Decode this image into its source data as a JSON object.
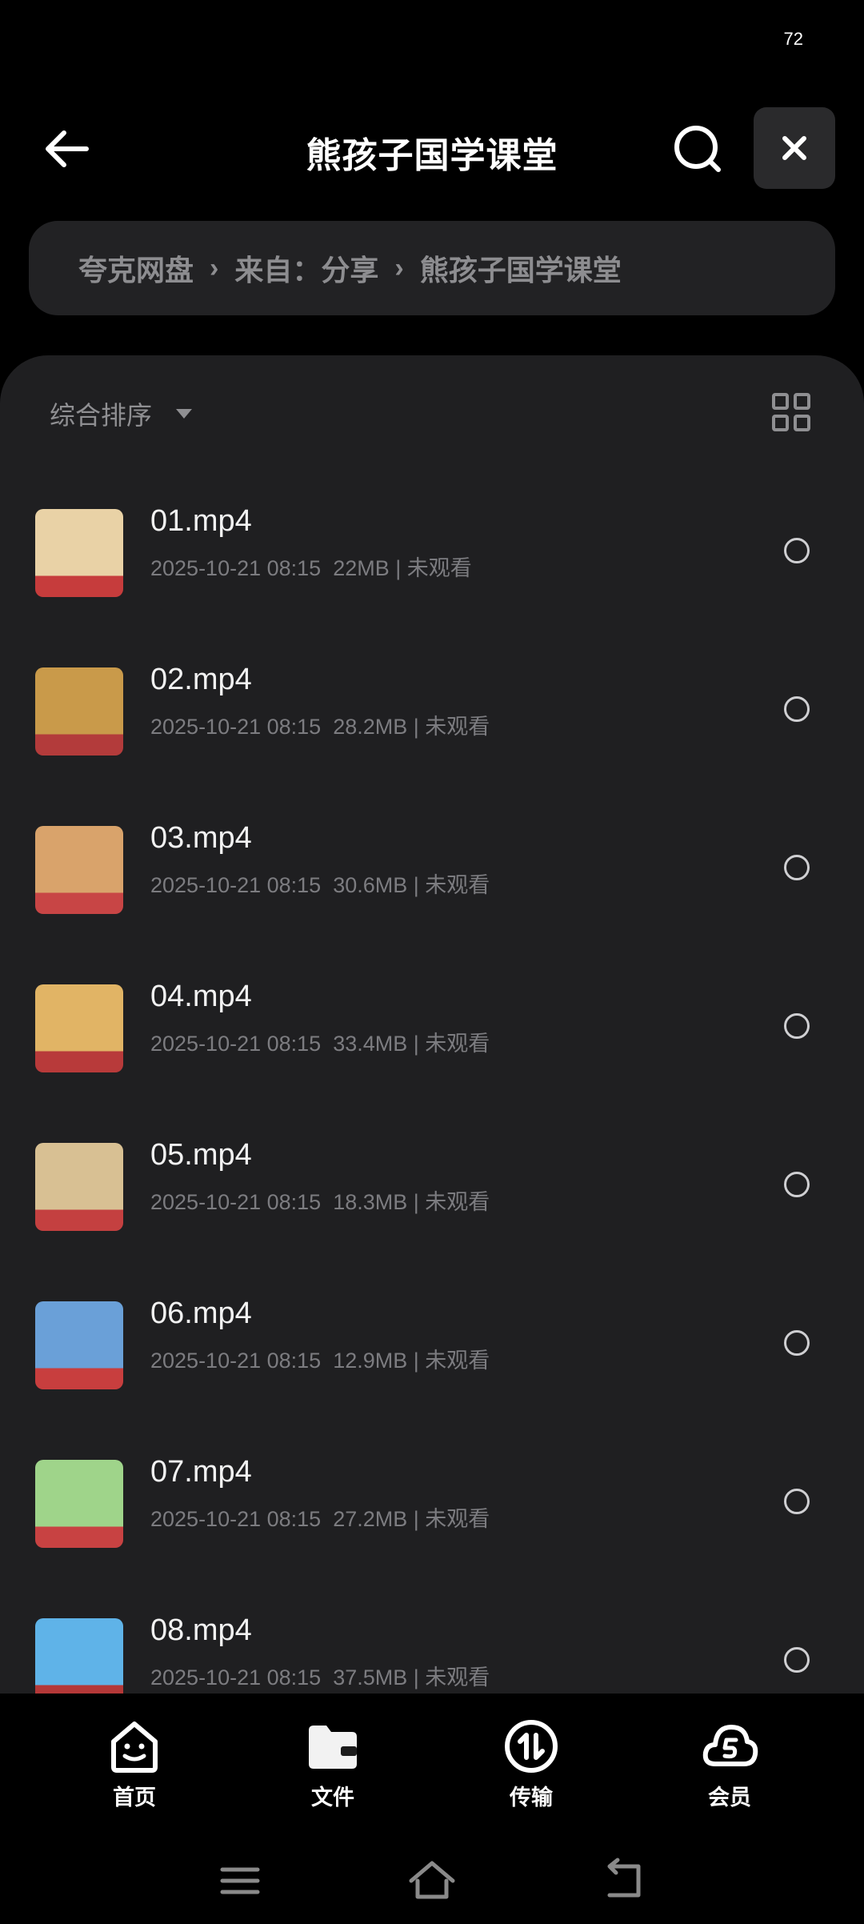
{
  "status_bar": {
    "battery": "72"
  },
  "header": {
    "title": "熊孩子国学课堂"
  },
  "breadcrumb": {
    "items": [
      "夸克网盘",
      "来自：分享",
      "熊孩子国学课堂"
    ]
  },
  "toolbar": {
    "sort_label": "综合排序"
  },
  "files": [
    {
      "name": "01.mp4",
      "date": "2025-10-21 08:15",
      "size": "22MB",
      "status": "未观看",
      "thumb_colors": [
        "#e9d2a6",
        "#c63c3c"
      ]
    },
    {
      "name": "02.mp4",
      "date": "2025-10-21 08:15",
      "size": "28.2MB",
      "status": "未观看",
      "thumb_colors": [
        "#c99a4a",
        "#b33b3b"
      ]
    },
    {
      "name": "03.mp4",
      "date": "2025-10-21 08:15",
      "size": "30.6MB",
      "status": "未观看",
      "thumb_colors": [
        "#d9a36b",
        "#c84545"
      ]
    },
    {
      "name": "04.mp4",
      "date": "2025-10-21 08:15",
      "size": "33.4MB",
      "status": "未观看",
      "thumb_colors": [
        "#e1b465",
        "#b83a3a"
      ]
    },
    {
      "name": "05.mp4",
      "date": "2025-10-21 08:15",
      "size": "18.3MB",
      "status": "未观看",
      "thumb_colors": [
        "#d8c093",
        "#c44040"
      ]
    },
    {
      "name": "06.mp4",
      "date": "2025-10-21 08:15",
      "size": "12.9MB",
      "status": "未观看",
      "thumb_colors": [
        "#6aa0d8",
        "#c83e3e"
      ]
    },
    {
      "name": "07.mp4",
      "date": "2025-10-21 08:15",
      "size": "27.2MB",
      "status": "未观看",
      "thumb_colors": [
        "#9fd48a",
        "#c84242"
      ]
    },
    {
      "name": "08.mp4",
      "date": "2025-10-21 08:15",
      "size": "37.5MB",
      "status": "未观看",
      "thumb_colors": [
        "#5fb3e8",
        "#b43838"
      ]
    }
  ],
  "bottom_nav": [
    {
      "label": "首页",
      "icon": "home-face-icon"
    },
    {
      "label": "文件",
      "icon": "folder-icon"
    },
    {
      "label": "传输",
      "icon": "transfer-icon"
    },
    {
      "label": "会员",
      "icon": "vip-cloud-icon"
    }
  ]
}
